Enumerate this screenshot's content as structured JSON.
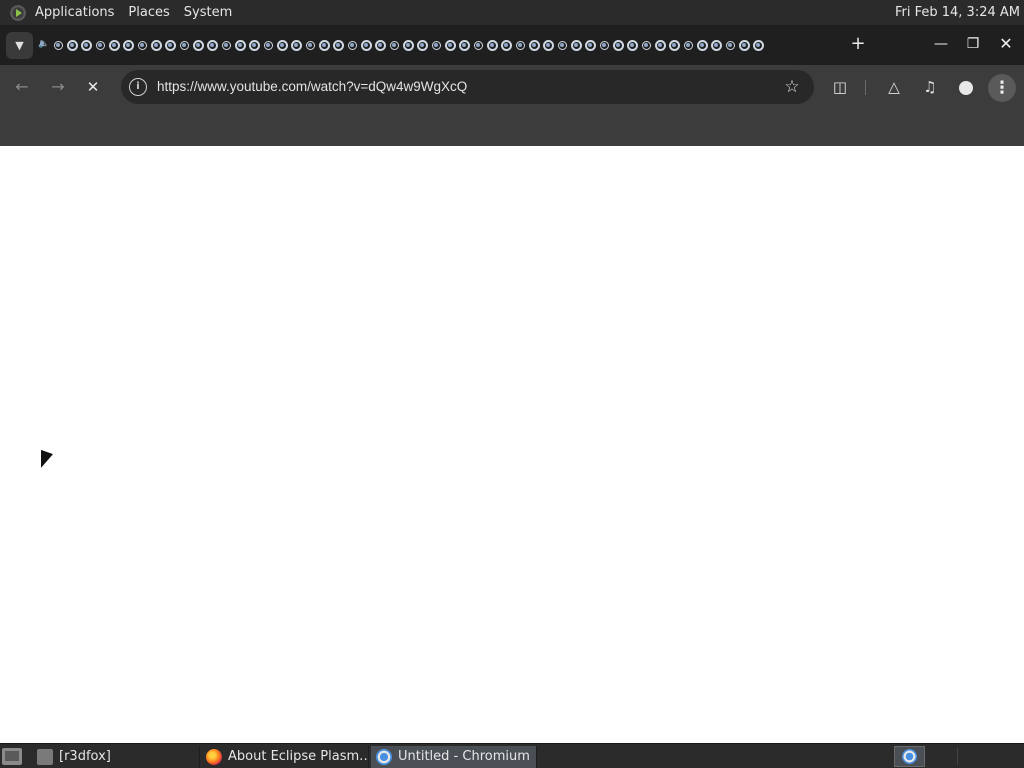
{
  "top_panel": {
    "menus": [
      "Applications",
      "Places",
      "System"
    ],
    "clock": "Fri Feb 14,  3:24 AM"
  },
  "browser": {
    "tab_count": 52,
    "new_tab_label": "+",
    "url": "https://www.youtube.com/watch?v=dQw4w9WgXcQ",
    "icons": {
      "tab_search": "chevron-down-icon",
      "back": "arrow-left-icon",
      "forward": "arrow-right-icon",
      "stop": "close-icon",
      "site_info": "info-icon",
      "bookmark": "star-icon",
      "extensions": "puzzle-icon",
      "labs": "flask-icon",
      "media": "media-control-icon",
      "profile": "person-icon",
      "menu": "three-dots-icon"
    }
  },
  "taskbar": {
    "tasks": [
      {
        "label": "[r3dfox]",
        "icon": "folder-icon"
      },
      {
        "label": "About Eclipse Plasm…",
        "icon": "firefox-icon"
      },
      {
        "label": "Untitled - Chromium",
        "icon": "chromium-icon",
        "active": true
      }
    ]
  },
  "colors": {
    "panel_bg": "#2b2b2b",
    "tabstrip_bg": "#1f1f1f",
    "toolbar_bg": "#3c3c3c",
    "omnibox_bg": "#282828",
    "active_task_bg": "#4a4f56"
  }
}
